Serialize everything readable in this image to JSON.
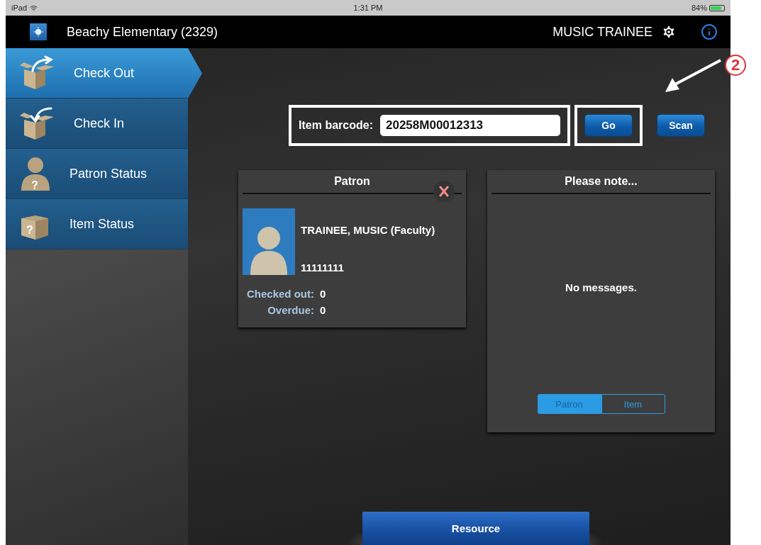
{
  "status_bar": {
    "device": "iPad",
    "time": "1:31 PM",
    "battery": "84%"
  },
  "header": {
    "title": "Beachy Elementary (2329)",
    "user": "MUSIC TRAINEE"
  },
  "sidebar": {
    "items": [
      {
        "label": "Check Out",
        "kind": "check-out",
        "selected": true
      },
      {
        "label": "Check In",
        "kind": "check-in",
        "selected": false
      },
      {
        "label": "Patron Status",
        "kind": "patron-status",
        "selected": false,
        "icon_mark": "?"
      },
      {
        "label": "Item Status",
        "kind": "item-status",
        "selected": false,
        "icon_mark": "?"
      }
    ]
  },
  "barcode": {
    "label": "Item barcode:",
    "value": "20258M00012313",
    "annotated": true
  },
  "buttons": [
    {
      "label": "Go",
      "annotated": true
    },
    {
      "label": "Scan",
      "annotated": false
    }
  ],
  "annotation": {
    "number": "2"
  },
  "patron_panel": {
    "title": "Patron",
    "name": "TRAINEE, MUSIC (Faculty)",
    "id": "11111111",
    "stats": [
      {
        "label": "Checked out:",
        "value": "0"
      },
      {
        "label": "Overdue:",
        "value": "0"
      }
    ]
  },
  "note_panel": {
    "title": "Please note...",
    "message": "No messages.",
    "segments": [
      {
        "label": "Patron",
        "selected": true
      },
      {
        "label": "Item",
        "selected": false
      }
    ]
  },
  "footer_button": {
    "label": "Resource"
  }
}
